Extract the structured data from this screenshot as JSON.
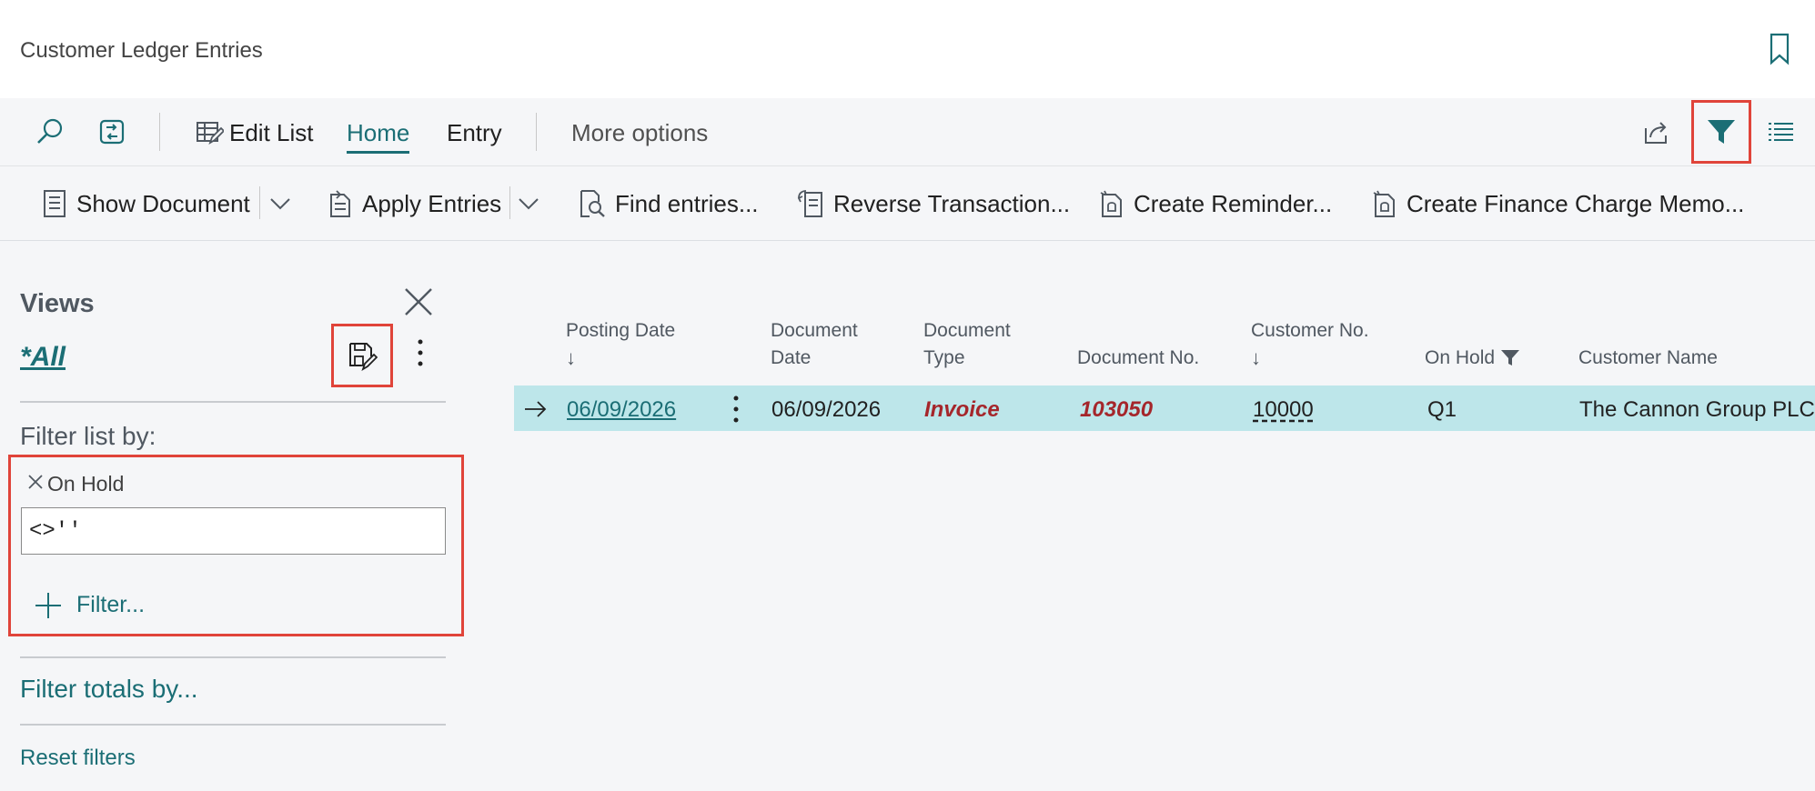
{
  "header": {
    "title": "Customer Ledger Entries"
  },
  "actionbar": {
    "edit_list": "Edit List",
    "tabs": [
      {
        "label": "Home"
      },
      {
        "label": "Entry"
      }
    ],
    "more_options": "More options"
  },
  "promoted": {
    "show_document": "Show Document",
    "apply_entries": "Apply Entries",
    "find_entries": "Find entries...",
    "reverse_transaction": "Reverse Transaction...",
    "create_reminder": "Create Reminder...",
    "create_finance_charge_memo": "Create Finance Charge Memo..."
  },
  "filter_pane": {
    "views_title": "Views",
    "current_view": "*All",
    "filter_list_by": "Filter list by:",
    "active_filter": {
      "field": "On Hold",
      "value": "<>''"
    },
    "add_filter": "Filter...",
    "filter_totals_by": "Filter totals by...",
    "reset_filters": "Reset filters"
  },
  "grid": {
    "columns": {
      "posting_date": {
        "line1": "Posting Date",
        "arrow": "↓"
      },
      "document_date": {
        "line1": "Document",
        "line2": "Date"
      },
      "document_type": {
        "line1": "Document",
        "line2": "Type"
      },
      "document_no": {
        "line1": "Document No."
      },
      "customer_no": {
        "line1": "Customer No.",
        "arrow": "↓"
      },
      "on_hold": {
        "line1": "On Hold"
      },
      "customer_name": {
        "line1": "Customer Name"
      }
    },
    "rows": [
      {
        "posting_date": "06/09/2026",
        "document_date": "06/09/2026",
        "document_type": "Invoice",
        "document_no": "103050",
        "customer_no": "10000",
        "on_hold": "Q1",
        "customer_name": "The Cannon Group PLC"
      }
    ]
  },
  "colors": {
    "accent": "#1b6e75",
    "highlight_box": "#e0443a",
    "selected_row": "#bde6ea",
    "document_red": "#a5262b"
  },
  "icons": {
    "search": "search-icon",
    "page_switch": "page-switch-icon",
    "edit_list": "edit-list-icon",
    "share": "share-icon",
    "filter": "filter-icon",
    "list_view": "list-view-icon",
    "bookmark": "bookmark-icon",
    "save_view": "save-view-icon",
    "close": "close-icon"
  }
}
